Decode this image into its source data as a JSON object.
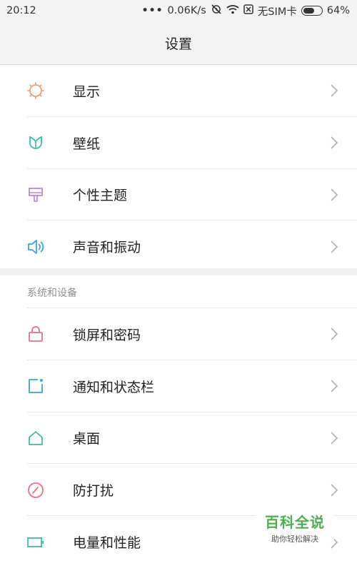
{
  "status_bar": {
    "time": "20:12",
    "dots": "•••",
    "speed": "0.06K/s",
    "sim_text": "无SIM卡",
    "battery_percent": "64%",
    "battery_level": 0.64
  },
  "header": {
    "title": "设置"
  },
  "group1": [
    {
      "label": "显示",
      "icon": "brightness-icon",
      "color": "#f0a070"
    },
    {
      "label": "壁纸",
      "icon": "wallpaper-icon",
      "color": "#3dbfa3"
    },
    {
      "label": "个性主题",
      "icon": "theme-brush-icon",
      "color": "#b48be6"
    },
    {
      "label": "声音和振动",
      "icon": "speaker-icon",
      "color": "#3aa6d9"
    }
  ],
  "section": {
    "title": "系统和设备"
  },
  "group2": [
    {
      "label": "锁屏和密码",
      "icon": "lock-icon",
      "color": "#e8708a"
    },
    {
      "label": "通知和状态栏",
      "icon": "notification-icon",
      "color": "#3aa6d9"
    },
    {
      "label": "桌面",
      "icon": "home-icon",
      "color": "#3dbfa3"
    },
    {
      "label": "防打扰",
      "icon": "do-not-disturb-icon",
      "color": "#e8708a"
    },
    {
      "label": "电量和性能",
      "icon": "battery-icon",
      "color": "#3dbfa3"
    }
  ],
  "watermark": {
    "title": "百科全说",
    "subtitle": "助你轻松解决"
  }
}
